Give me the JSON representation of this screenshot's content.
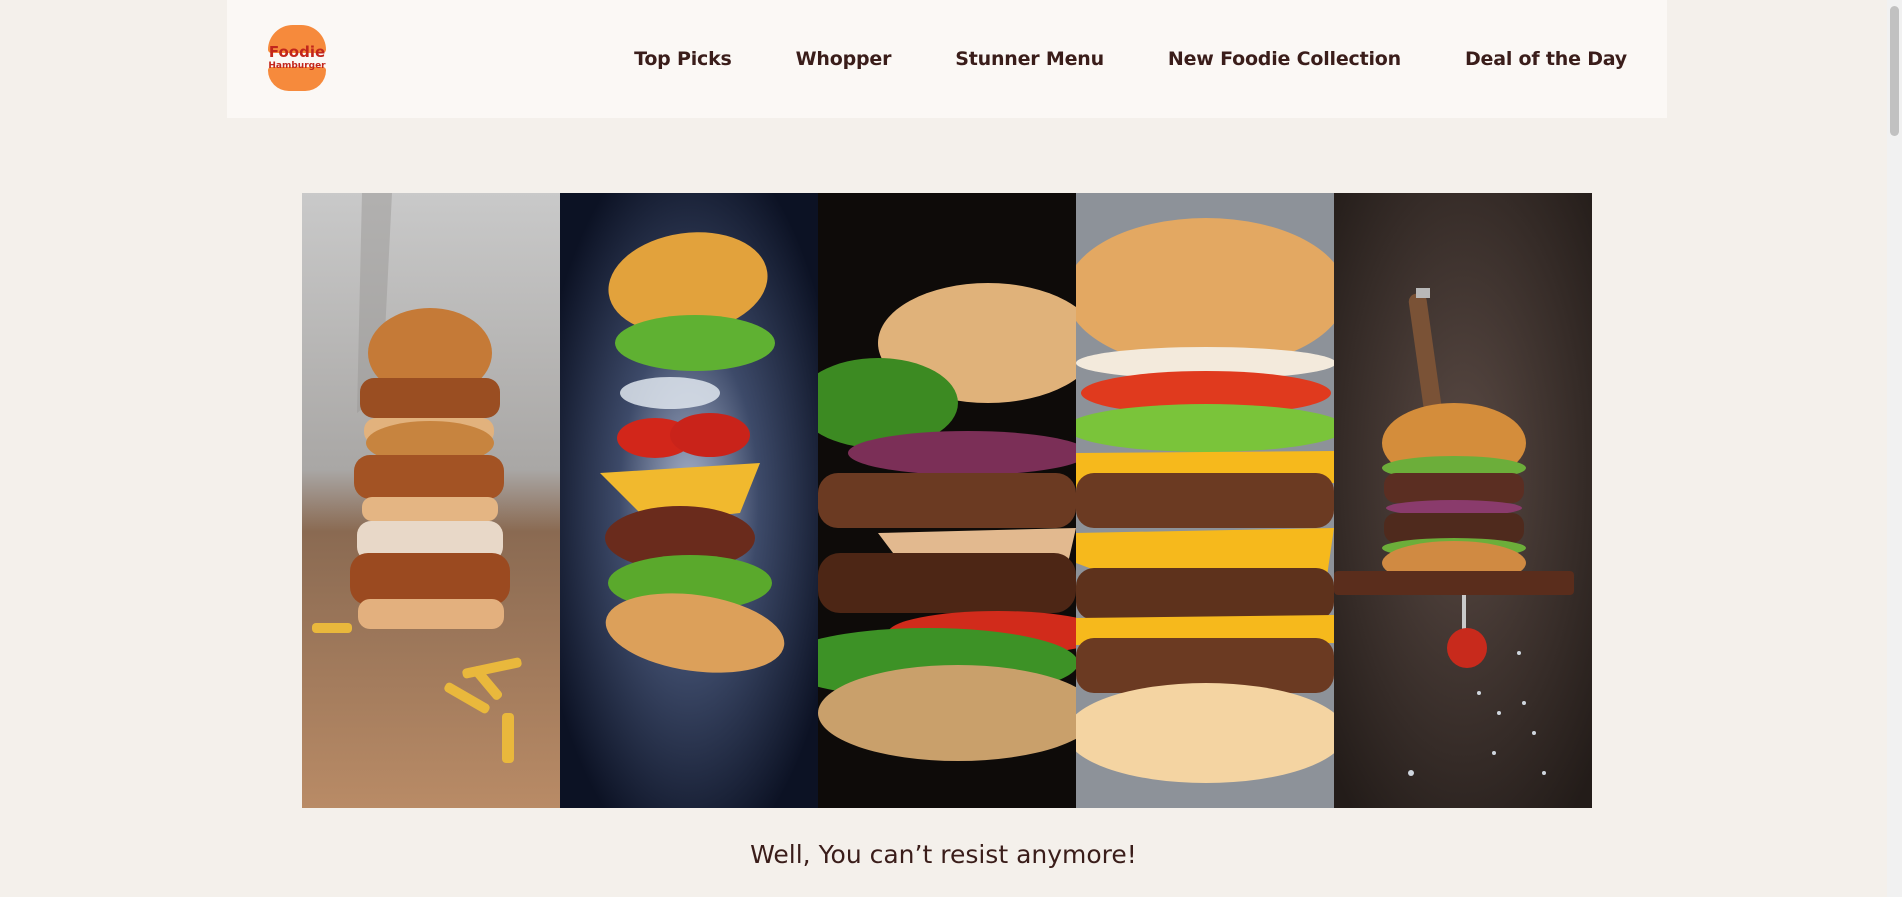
{
  "logo": {
    "line1": "Foodie",
    "line2": "Hamburger"
  },
  "nav": {
    "items": [
      "Top Picks",
      "Whopper",
      "Stunner Menu",
      "New Foodie Collection",
      "Deal of the Day"
    ]
  },
  "tagline": "Well, You can’t resist anymore!",
  "colors": {
    "background": "#f4f0eb",
    "header": "#fbf8f5",
    "brand_orange": "#f68a3c",
    "brand_red": "#c2261c",
    "text_dark": "#3a1d1a"
  }
}
